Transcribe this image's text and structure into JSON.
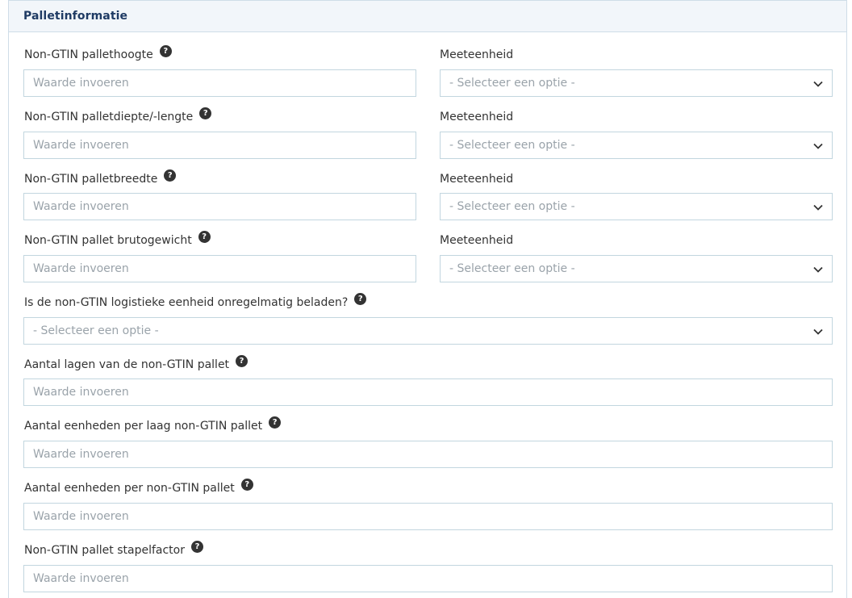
{
  "header": {
    "title": "Palletinformatie"
  },
  "help_glyph": "?",
  "input_placeholder": "Waarde invoeren",
  "select_placeholder": "- Selecteer een optie -",
  "unit_label": "Meeteenheid",
  "fields": {
    "height": {
      "label": "Non-GTIN pallethoogte"
    },
    "depth": {
      "label": "Non-GTIN palletdiepte/-lengte"
    },
    "width": {
      "label": "Non-GTIN palletbreedte"
    },
    "weight": {
      "label": "Non-GTIN pallet brutogewicht"
    },
    "irregular": {
      "label": "Is de non-GTIN logistieke eenheid onregelmatig beladen?"
    },
    "layers": {
      "label": "Aantal lagen van de non-GTIN pallet"
    },
    "units_per_layer": {
      "label": "Aantal eenheden per laag non-GTIN pallet"
    },
    "units_per_pallet": {
      "label": "Aantal eenheden per non-GTIN pallet"
    },
    "stack_factor": {
      "label": "Non-GTIN pallet stapelfactor"
    }
  },
  "icons": {
    "help": "question-circle-icon",
    "dropdown": "chevron-down-icon"
  },
  "colors": {
    "header_bg": "#f2f6fa",
    "title": "#1f3b64",
    "border": "#c2d6df",
    "placeholder": "#9aa3aa"
  }
}
